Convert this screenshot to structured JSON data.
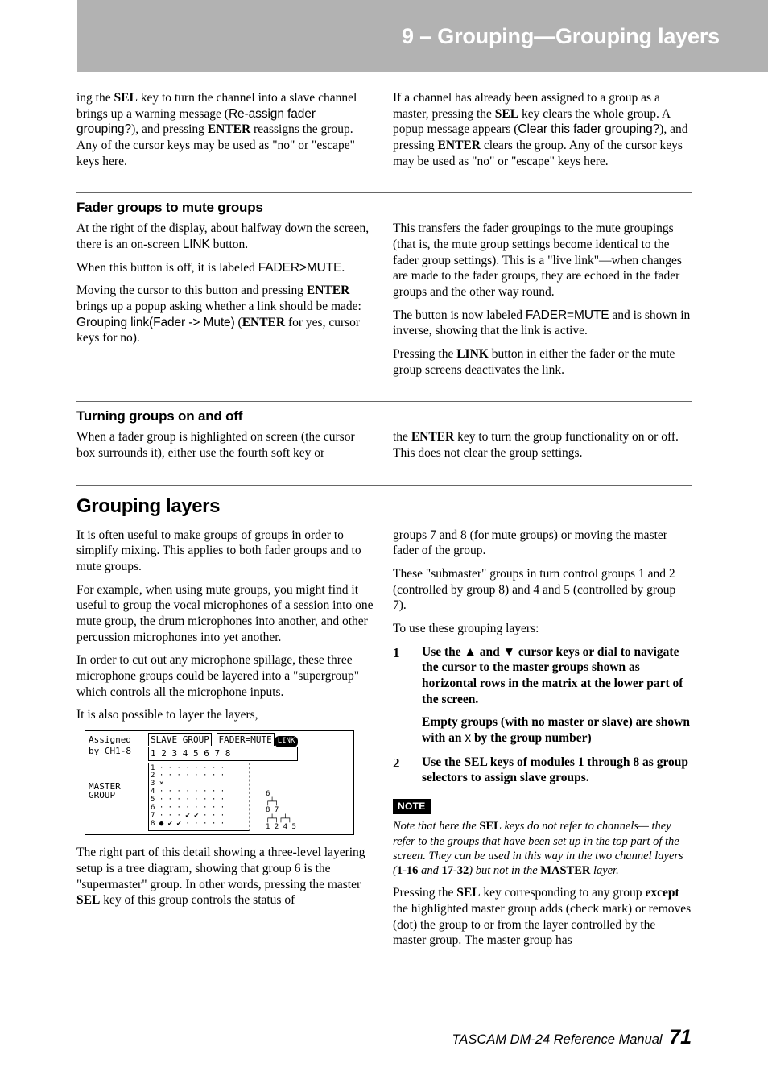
{
  "header": {
    "title": "9 – Grouping—Grouping layers"
  },
  "cols_top": {
    "left_p1_a": "ing the ",
    "left_p1_sel": "SEL",
    "left_p1_b": " key to turn the channel into a slave channel brings up a warning message (",
    "left_p1_mono": "Re-assign fader grouping?",
    "left_p1_c": "), and pressing ",
    "left_p1_enter": "ENTER",
    "left_p1_d": " reassigns the group. Any of the cursor keys may be used as \"no\" or \"escape\" keys here.",
    "right_p1_a": "If a channel has already been assigned to a group as a master, pressing the ",
    "right_p1_sel": "SEL",
    "right_p1_b": " key clears the whole group. A popup message appears (",
    "right_p1_mono": "Clear this fader grouping?",
    "right_p1_c": "), and pressing ",
    "right_p1_enter": "ENTER",
    "right_p1_d": " clears the group. Any of the cursor keys may be used as \"no\" or \"escape\" keys here."
  },
  "fader": {
    "heading": "Fader groups to mute groups",
    "left_p1_a": "At the right of the display, about halfway down the screen, there is an on-screen ",
    "left_p1_mono": "LINK",
    "left_p1_b": " button.",
    "left_p2_a": "When this button is off, it is labeled ",
    "left_p2_mono": "FADER>MUTE",
    "left_p2_b": ".",
    "left_p3_a": "Moving the cursor to this button and pressing ",
    "left_p3_enter": "ENTER",
    "left_p3_b": " brings up a popup asking whether a link should be made: ",
    "left_p3_mono": "Grouping link(Fader -> Mute)",
    "left_p3_c": " (",
    "left_p3_enter2": "ENTER",
    "left_p3_d": " for yes, cursor keys for no).",
    "right_p1": "This transfers the fader groupings to the mute groupings (that is, the mute group settings become identical to the fader group settings). This is a \"live link\"—when changes are made to the fader groups, they are echoed in the fader groups and the other way round.",
    "right_p2_a": "The button is now labeled ",
    "right_p2_mono": "FADER=MUTE",
    "right_p2_b": " and is shown in inverse, showing that the link is active.",
    "right_p3_a": "Pressing the ",
    "right_p3_link": "LINK",
    "right_p3_b": " button in either the fader or the mute group screens deactivates the link."
  },
  "turning": {
    "heading": "Turning groups on and off",
    "left_p1": "When a fader group is highlighted on screen (the cursor box surrounds it), either use the fourth soft key or",
    "right_p1_a": "the ",
    "right_p1_enter": "ENTER",
    "right_p1_b": " key to turn the group functionality on or off. This does not clear the group settings."
  },
  "layers": {
    "heading": "Grouping layers",
    "left_p1": "It is often useful to make groups of groups in order to simplify mixing. This applies to both fader groups and to mute groups.",
    "left_p2": "For example, when using mute groups, you might find it useful to group the vocal microphones of a session into one mute group, the drum microphones into another, and other percussion microphones into yet another.",
    "left_p3": "In order to cut out any microphone spillage, these three microphone groups could be layered into a \"supergroup\" which controls all the microphone inputs.",
    "left_p4": "It is also possible to layer the layers,",
    "left_p5_a": "The right part of this detail showing a three-level layering setup is a tree diagram, showing that group 6 is the \"supermaster\" group. In other words, pressing the master ",
    "left_p5_sel": "SEL",
    "left_p5_b": " key of this group controls the status of",
    "right_p1": "groups 7 and 8 (for mute groups) or moving the master fader of the group.",
    "right_p2": "These \"submaster\" groups in turn control groups 1 and 2 (controlled by group 8) and 4 and 5 (controlled by group 7).",
    "right_p3": "To use these grouping layers:",
    "step1_num": "1",
    "step1_a": "Use the ▲ and ▼ cursor keys or dial to navigate the cursor to the master groups shown as horizontal rows in the matrix at the lower part of the screen.",
    "step1_b_a": "Empty groups (with no master or slave) are shown with an ",
    "step1_b_mono": "x",
    "step1_b_b": " by the group number)",
    "step2_num": "2",
    "step2_a": "Use the ",
    "step2_sel": "SEL",
    "step2_b": " keys of modules 1 through 8 as group selectors to assign slave groups.",
    "note_tag": "NOTE",
    "note_a": "Note that here the ",
    "note_sel": "SEL",
    "note_b": " keys do not refer to channels— they refer to the groups that have been set up in the top part of the screen. They can be used in this way in the two channel layers (",
    "note_116": "1-16",
    "note_and": " and ",
    "note_1732": "17-32",
    "note_c": ") but not in the ",
    "note_master": "MASTER",
    "note_d": " layer.",
    "right_p4_a": "Pressing the ",
    "right_p4_sel": "SEL",
    "right_p4_b": " key corresponding to any group ",
    "right_p4_except": "except",
    "right_p4_c": " the highlighted master group adds (check mark) or removes (dot) the group to or from the layer controlled by the master group. The master group has"
  },
  "figure": {
    "left_top": "Assigned",
    "left_bottom": "by CH1-8",
    "slave_label": "SLAVE GROUP",
    "nums": "1 2 3 4 5 6 7 8",
    "fader_label": "FADER=MUTE",
    "link": "LINK",
    "side_a": "MASTER",
    "side_b": "GROUP",
    "tree_top": "6",
    "tree_mid": "8   7",
    "tree_bot": "1 2 4 5"
  },
  "footer": {
    "text": "TASCAM DM-24 Reference Manual",
    "page": "71"
  }
}
